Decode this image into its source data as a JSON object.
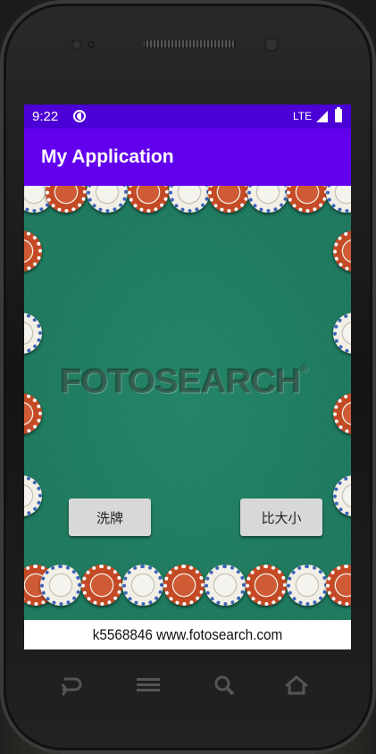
{
  "status_bar": {
    "time": "9:22",
    "network": "LTE",
    "icons": [
      "data-saver-icon",
      "signal-icon",
      "battery-icon"
    ]
  },
  "app_bar": {
    "title": "My Application"
  },
  "table": {
    "watermark": "FOTOSEARCH",
    "watermark_mark": "®",
    "shuffle_button": "洗牌",
    "compare_button": "比大小",
    "caption": "k5568846 www.fotosearch.com"
  },
  "nav_bar": {
    "icons": [
      "back-icon",
      "menu-icon",
      "search-icon",
      "home-icon"
    ]
  },
  "colors": {
    "status_bar": "#4b00d6",
    "app_bar": "#6200ee",
    "felt": "#1e7a5f",
    "chip_red": "#c44a26",
    "chip_white": "#f2efe6",
    "button": "#d8d8d8"
  }
}
